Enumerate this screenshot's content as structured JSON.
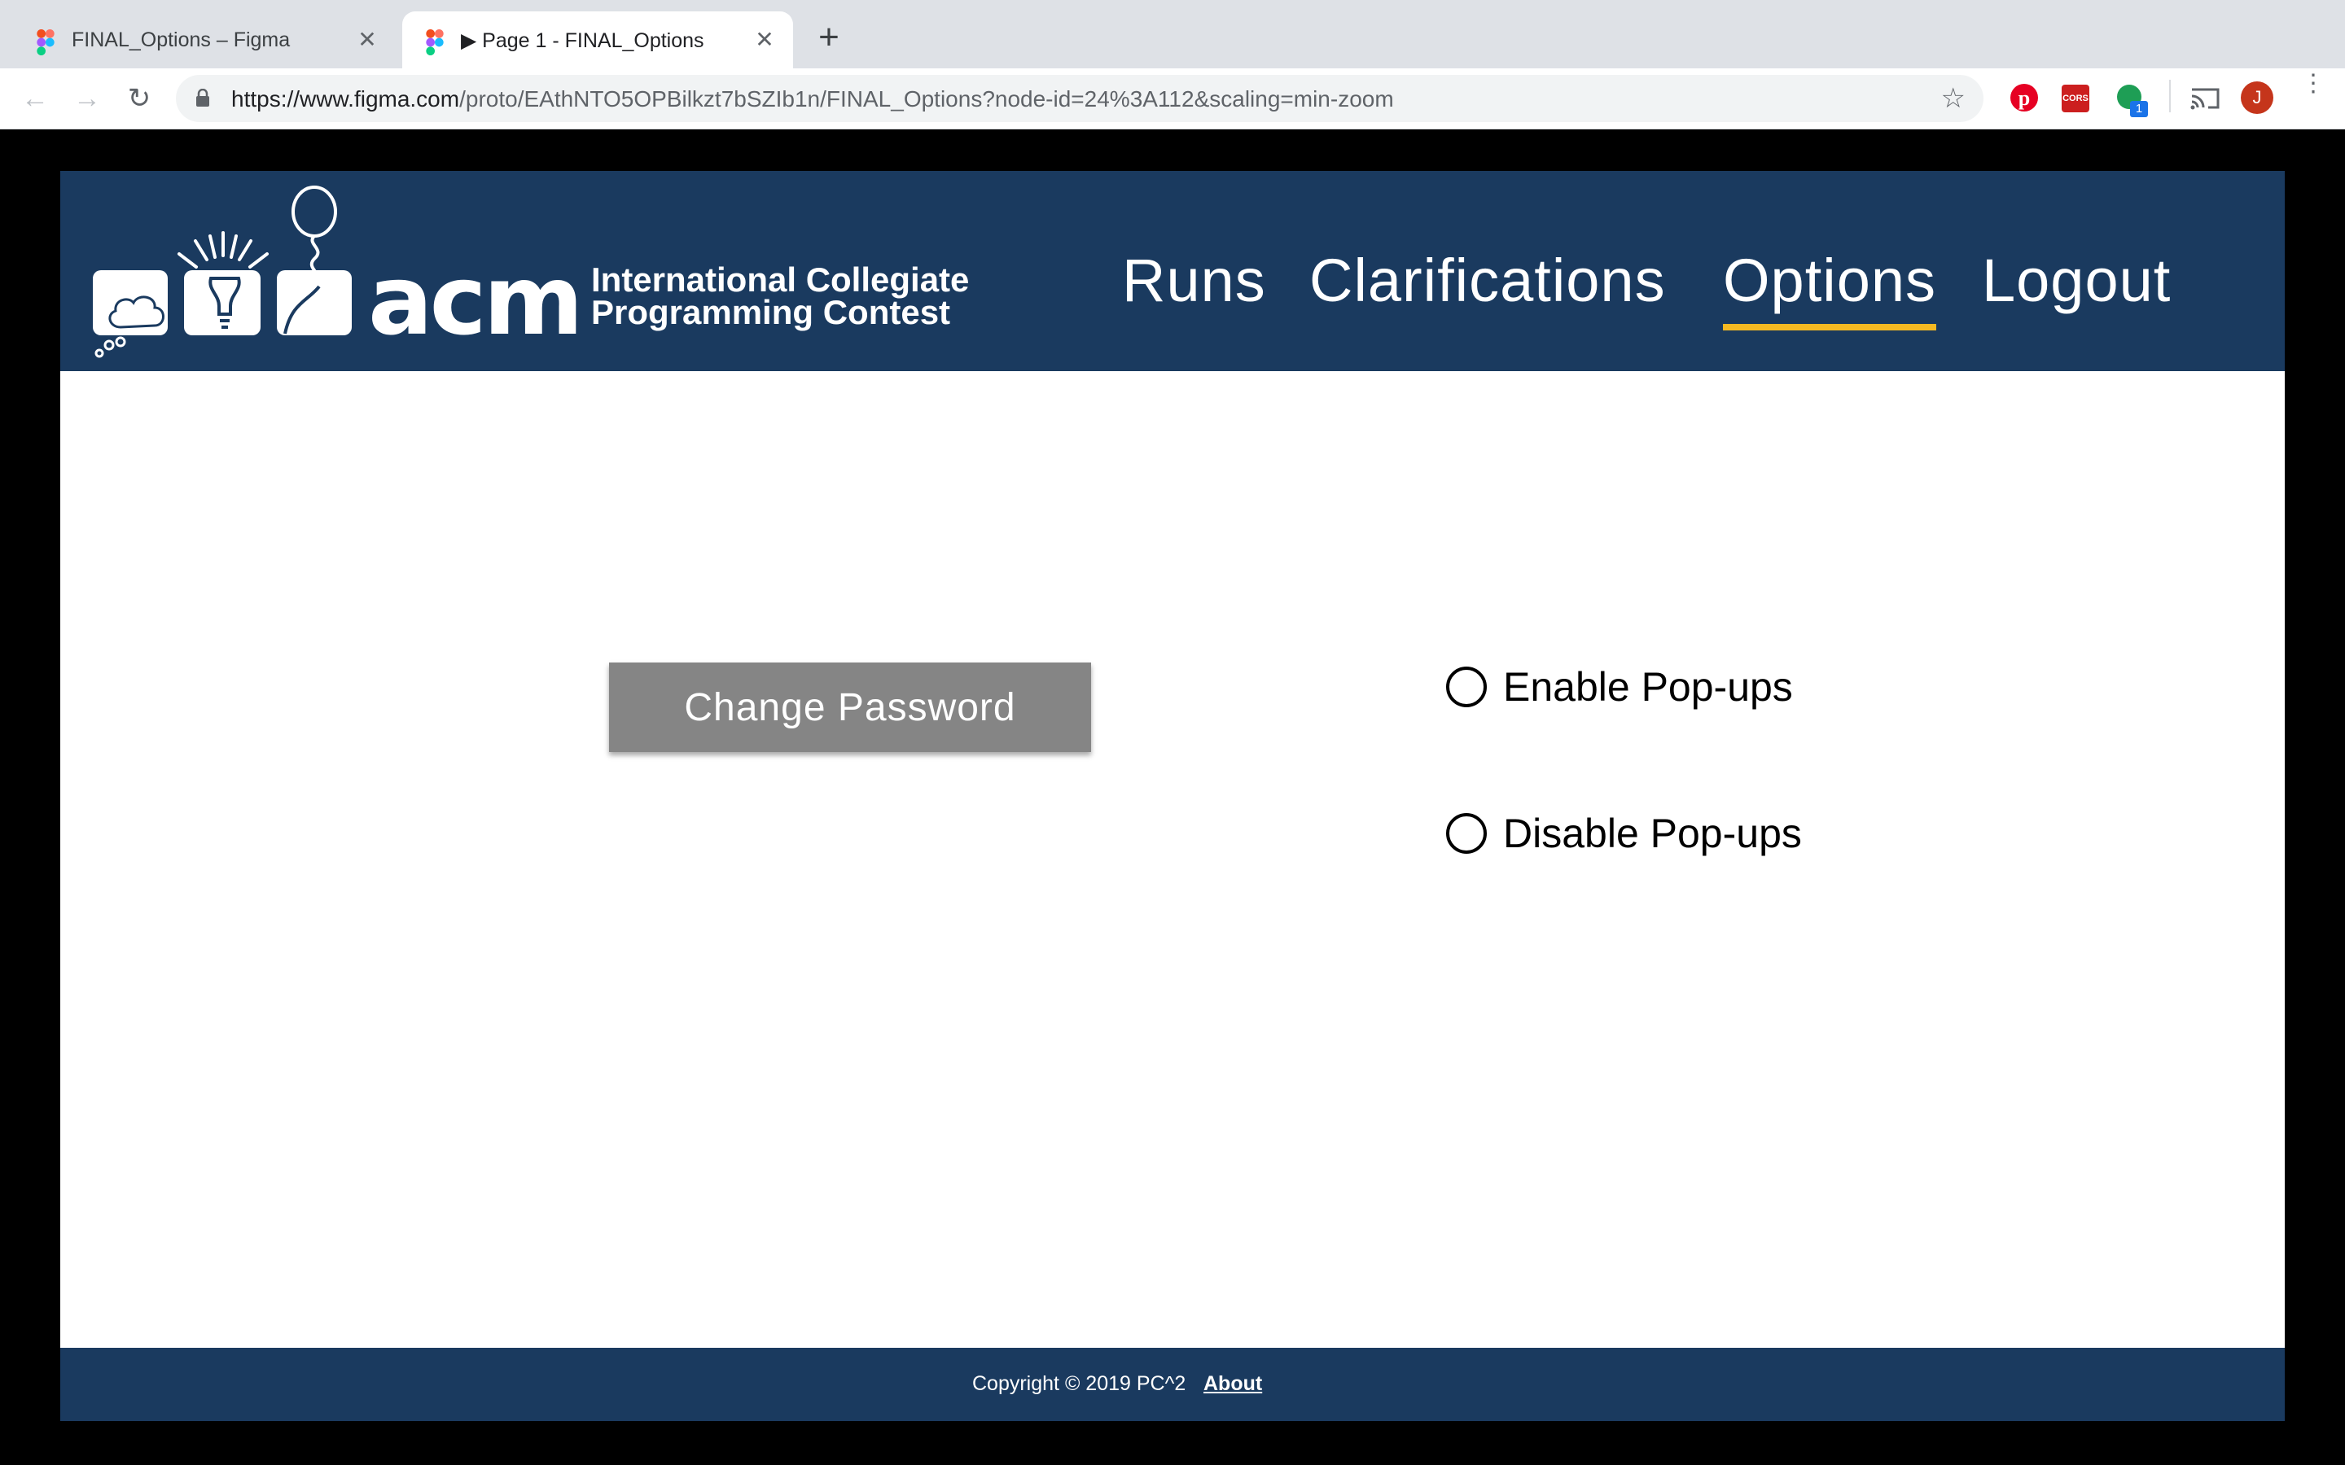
{
  "browser": {
    "tabs": [
      {
        "title": "FINAL_Options – Figma",
        "active": false
      },
      {
        "title": "▶ Page 1 - FINAL_Options",
        "active": true
      }
    ],
    "url_host": "https://www.figma.com",
    "url_path": "/proto/EAthNTO5OPBilkzt7bSZIb1n/FINAL_Options?node-id=24%3A112&scaling=min-zoom",
    "extensions": {
      "cors_label": "CORS",
      "badge_count": "1",
      "profile_initial": "J"
    }
  },
  "header": {
    "logo_text": "acm",
    "logo_line1": "International Collegiate",
    "logo_line2": "Programming Contest",
    "nav": [
      {
        "label": "Runs",
        "active": false
      },
      {
        "label": "Clarifications",
        "active": false
      },
      {
        "label": "Options",
        "active": true
      },
      {
        "label": "Logout",
        "active": false
      }
    ]
  },
  "main": {
    "change_password_label": "Change Password",
    "options": [
      {
        "label": "Enable Pop-ups",
        "selected": false
      },
      {
        "label": "Disable Pop-ups",
        "selected": false
      }
    ]
  },
  "footer": {
    "copyright": "Copyright © 2019 PC^2",
    "about": "About"
  },
  "colors": {
    "header_bg": "#1a3a5f",
    "active_underline": "#f5b922",
    "button_bg": "#858585"
  }
}
